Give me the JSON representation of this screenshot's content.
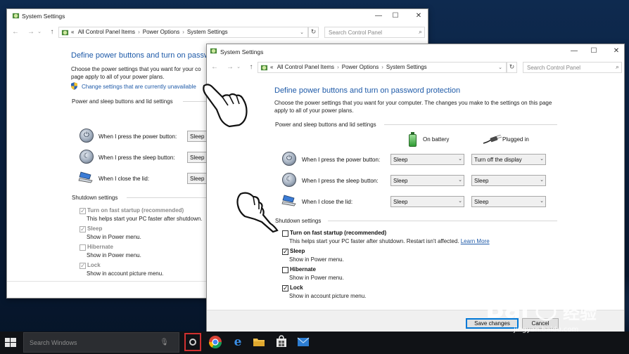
{
  "window_title": "System Settings",
  "breadcrumb": [
    "All Control Panel Items",
    "Power Options",
    "System Settings"
  ],
  "breadcrumb_prefix": "«",
  "search_placeholder": "Search Control Panel",
  "heading": "Define power buttons and turn on password protection",
  "heading_back": "Define power buttons and turn on passw",
  "description": "Choose the power settings that you want for your computer. The changes you make to the settings on this page apply to all of your power plans.",
  "description_back_line1": "Choose the power settings that you want for your co",
  "description_back_line2": "page apply to all of your power plans.",
  "change_settings_link": "Change settings that are currently unavailable",
  "section_power": "Power and sleep buttons and lid settings",
  "column_battery": "On battery",
  "column_plugged": "Plugged in",
  "rows": [
    {
      "label": "When I press the power button:",
      "battery": "Sleep",
      "plugged": "Turn off the display",
      "back_value": "Sleep"
    },
    {
      "label": "When I press the sleep button:",
      "battery": "Sleep",
      "plugged": "Sleep",
      "back_value": "Sleep"
    },
    {
      "label": "When I close the lid:",
      "battery": "Sleep",
      "plugged": "Sleep",
      "back_value": "Sleep"
    }
  ],
  "section_shutdown": "Shutdown settings",
  "shutdown_options": [
    {
      "label": "Turn on fast startup (recommended)",
      "desc": "This helps start your PC faster after shutdown. Restart isn't affected.",
      "desc_back": "This helps start your PC faster after shutdown.",
      "checked_front": false,
      "checked_back": true
    },
    {
      "label": "Sleep",
      "desc": "Show in Power menu.",
      "checked_front": true,
      "checked_back": true
    },
    {
      "label": "Hibernate",
      "desc": "Show in Power menu.",
      "checked_front": false,
      "checked_back": false
    },
    {
      "label": "Lock",
      "desc": "Show in account picture menu.",
      "checked_front": true,
      "checked_back": true
    }
  ],
  "learn_more": "Learn More",
  "save_button": "Save changes",
  "cancel_button": "Cancel",
  "taskbar": {
    "search_placeholder": "Search Windows"
  },
  "watermark": {
    "brand": "Bai",
    "brand_cn": "经验",
    "url": "jingyan.baidu.com"
  },
  "colors": {
    "heading": "#1e5aa8",
    "taskbar": "#101216",
    "desktop": "#0a1f3d"
  },
  "icons": [
    "control-panel-icon",
    "power-icon",
    "sleep-moon-icon",
    "laptop-lid-icon",
    "battery-icon",
    "plug-icon",
    "shield-icon",
    "pointing-hand-icon"
  ]
}
